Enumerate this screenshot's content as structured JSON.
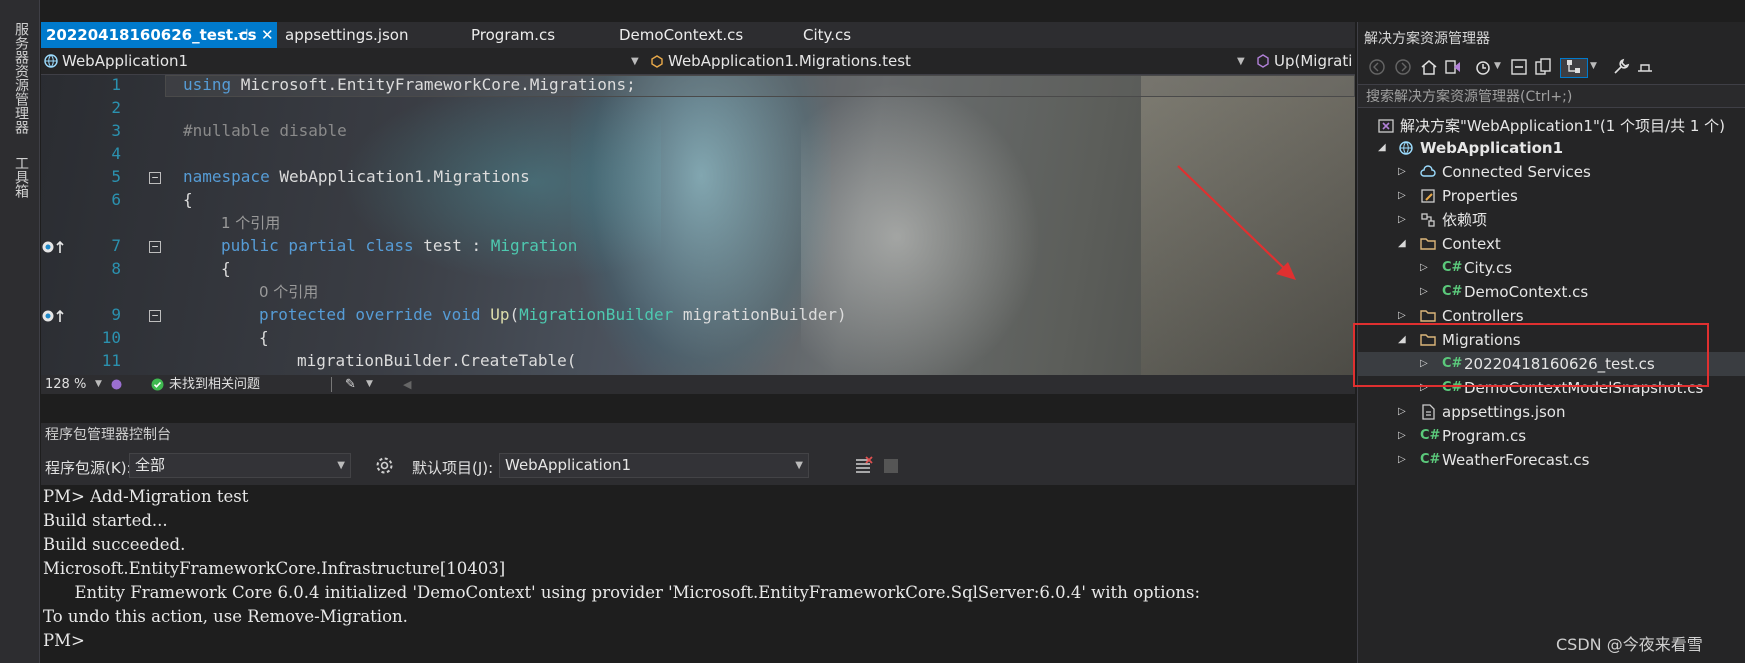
{
  "left_strip": {
    "tab1": "服务器资源管理器",
    "tab2": "工具箱"
  },
  "editor": {
    "tabs": [
      {
        "label": "20220418160626_test.cs",
        "pin": "⊣",
        "close": "✕"
      },
      {
        "label": "appsettings.json"
      },
      {
        "label": "Program.cs"
      },
      {
        "label": "DemoContext.cs"
      },
      {
        "label": "City.cs"
      }
    ],
    "nav": {
      "project": "WebApplication1",
      "type": "WebApplication1.Migrations.test",
      "member": "Up(Migrati"
    },
    "line_numbers": [
      "1",
      "2",
      "3",
      "4",
      "5",
      "6",
      "7",
      "8",
      "9",
      "10",
      "11"
    ],
    "code": {
      "l1_kw": "using",
      "l1_rest": " Microsoft.EntityFrameworkCore.Migrations;",
      "l3": "#nullable disable",
      "l5_kw": "namespace",
      "l5_rest": " WebApplication1.Migrations",
      "l6": "{",
      "ref1": "1 个引用",
      "l7_kw": "public partial class",
      "l7_name": " test : ",
      "l7_type": "Migration",
      "l8": "{",
      "ref2": "0 个引用",
      "l9_kw": "protected override void",
      "l9_fn": " Up",
      "l9_p1": "(",
      "l9_type": "MigrationBuilder",
      "l9_p2": " migrationBuilder)",
      "l10": "{",
      "l11": "migrationBuilder.CreateTable("
    },
    "status": {
      "zoom": "128 %",
      "issues": "未找到相关问题"
    }
  },
  "pmc": {
    "title": "程序包管理器控制台",
    "source_label": "程序包源(K):",
    "source_value": "全部",
    "project_label": "默认项目(J):",
    "project_value": "WebApplication1",
    "output": [
      "PM> Add-Migration test",
      "Build started...",
      "Build succeeded.",
      "Microsoft.EntityFrameworkCore.Infrastructure[10403]",
      "      Entity Framework Core 6.0.4 initialized 'DemoContext' using provider 'Microsoft.EntityFrameworkCore.SqlServer:6.0.4' with options:",
      "To undo this action, use Remove-Migration.",
      "PM>"
    ]
  },
  "solution_explorer": {
    "title": "解决方案资源管理器",
    "search_placeholder": "搜索解决方案资源管理器(Ctrl+;)",
    "solution": "解决方案\"WebApplication1\"(1 个项目/共 1 个)",
    "project": "WebApplication1",
    "items": {
      "connected": "Connected Services",
      "properties": "Properties",
      "deps": "依赖项",
      "context": "Context",
      "city": "City.cs",
      "democontext": "DemoContext.cs",
      "controllers": "Controllers",
      "migrations": "Migrations",
      "migration_file": "20220418160626_test.cs",
      "snapshot": "DemoContextModelSnapshot.cs",
      "appsettings": "appsettings.json",
      "program": "Program.cs",
      "weather": "WeatherForecast.cs"
    },
    "cs_badge": "C#"
  },
  "watermark": "CSDN @今夜来看雪",
  "colors": {
    "accent": "#007acc",
    "highlight_box": "#e03030",
    "keyword": "#569cd6",
    "type": "#4ec9b0"
  }
}
